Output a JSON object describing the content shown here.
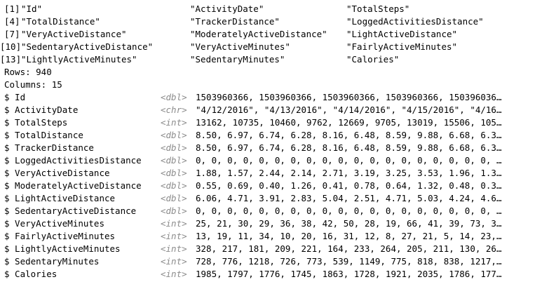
{
  "names": {
    "rows": [
      {
        "index": "[1]",
        "cols": [
          "\"Id\"",
          "\"ActivityDate\"",
          "\"TotalSteps\""
        ]
      },
      {
        "index": "[4]",
        "cols": [
          "\"TotalDistance\"",
          "\"TrackerDistance\"",
          "\"LoggedActivitiesDistance\""
        ]
      },
      {
        "index": "[7]",
        "cols": [
          "\"VeryActiveDistance\"",
          "\"ModeratelyActiveDistance\"",
          "\"LightActiveDistance\""
        ]
      },
      {
        "index": "[10]",
        "cols": [
          "\"SedentaryActiveDistance\"",
          "\"VeryActiveMinutes\"",
          "\"FairlyActiveMinutes\""
        ]
      },
      {
        "index": "[13]",
        "cols": [
          "\"LightlyActiveMinutes\"",
          "\"SedentaryMinutes\"",
          "\"Calories\""
        ]
      }
    ]
  },
  "summary": {
    "rows": "Rows: 940",
    "columns": "Columns: 15"
  },
  "glimpse": [
    {
      "name": "$ Id",
      "type": "<dbl>",
      "values": "1503960366, 1503960366, 1503960366, 1503960366, 150396036…"
    },
    {
      "name": "$ ActivityDate",
      "type": "<chr>",
      "values": "\"4/12/2016\", \"4/13/2016\", \"4/14/2016\", \"4/15/2016\", \"4/16…"
    },
    {
      "name": "$ TotalSteps",
      "type": "<int>",
      "values": "13162, 10735, 10460, 9762, 12669, 9705, 13019, 15506, 105…"
    },
    {
      "name": "$ TotalDistance",
      "type": "<dbl>",
      "values": "8.50, 6.97, 6.74, 6.28, 8.16, 6.48, 8.59, 9.88, 6.68, 6.3…"
    },
    {
      "name": "$ TrackerDistance",
      "type": "<dbl>",
      "values": "8.50, 6.97, 6.74, 6.28, 8.16, 6.48, 8.59, 9.88, 6.68, 6.3…"
    },
    {
      "name": "$ LoggedActivitiesDistance",
      "type": "<dbl>",
      "values": "0, 0, 0, 0, 0, 0, 0, 0, 0, 0, 0, 0, 0, 0, 0, 0, 0, 0, 0, …"
    },
    {
      "name": "$ VeryActiveDistance",
      "type": "<dbl>",
      "values": "1.88, 1.57, 2.44, 2.14, 2.71, 3.19, 3.25, 3.53, 1.96, 1.3…"
    },
    {
      "name": "$ ModeratelyActiveDistance",
      "type": "<dbl>",
      "values": "0.55, 0.69, 0.40, 1.26, 0.41, 0.78, 0.64, 1.32, 0.48, 0.3…"
    },
    {
      "name": "$ LightActiveDistance",
      "type": "<dbl>",
      "values": "6.06, 4.71, 3.91, 2.83, 5.04, 2.51, 4.71, 5.03, 4.24, 4.6…"
    },
    {
      "name": "$ SedentaryActiveDistance",
      "type": "<dbl>",
      "values": "0, 0, 0, 0, 0, 0, 0, 0, 0, 0, 0, 0, 0, 0, 0, 0, 0, 0, 0, …"
    },
    {
      "name": "$ VeryActiveMinutes",
      "type": "<int>",
      "values": "25, 21, 30, 29, 36, 38, 42, 50, 28, 19, 66, 41, 39, 73, 3…"
    },
    {
      "name": "$ FairlyActiveMinutes",
      "type": "<int>",
      "values": "13, 19, 11, 34, 10, 20, 16, 31, 12, 8, 27, 21, 5, 14, 23,…"
    },
    {
      "name": "$ LightlyActiveMinutes",
      "type": "<int>",
      "values": "328, 217, 181, 209, 221, 164, 233, 264, 205, 211, 130, 26…"
    },
    {
      "name": "$ SedentaryMinutes",
      "type": "<int>",
      "values": "728, 776, 1218, 726, 773, 539, 1149, 775, 818, 838, 1217,…"
    },
    {
      "name": "$ Calories",
      "type": "<int>",
      "values": "1985, 1797, 1776, 1745, 1863, 1728, 1921, 2035, 1786, 177…"
    }
  ]
}
